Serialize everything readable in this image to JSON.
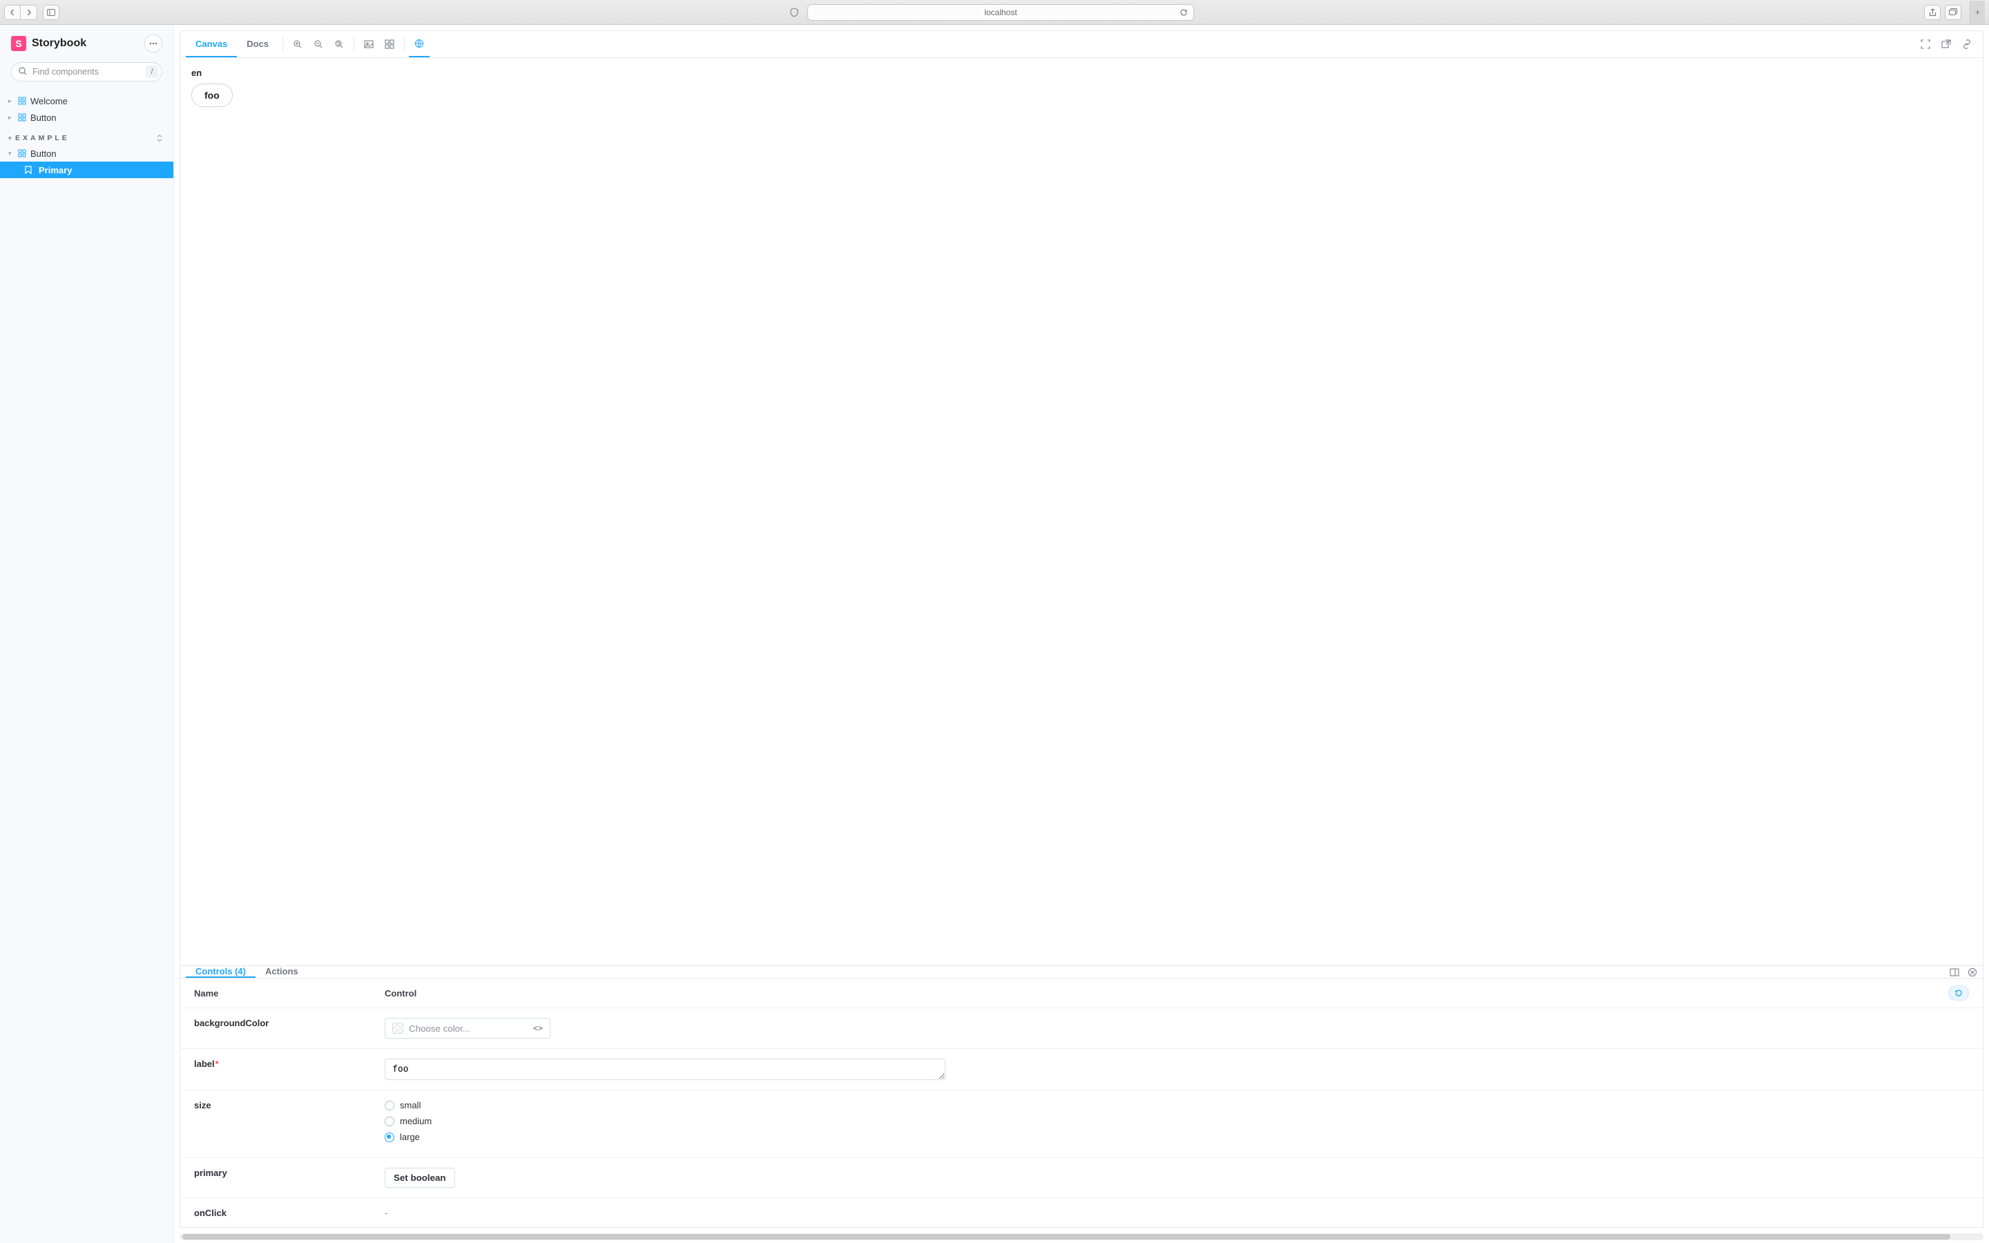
{
  "browser": {
    "url": "localhost"
  },
  "sidebar": {
    "brand": "Storybook",
    "search_placeholder": "Find components",
    "search_shortcut": "/",
    "root_items": [
      {
        "label": "Welcome"
      },
      {
        "label": "Button"
      }
    ],
    "sections": [
      {
        "title": "EXAMPLE",
        "components": [
          {
            "label": "Button",
            "expanded": true,
            "stories": [
              {
                "label": "Primary",
                "active": true
              }
            ]
          }
        ]
      }
    ]
  },
  "toolbar": {
    "tabs": [
      {
        "label": "Canvas",
        "active": true
      },
      {
        "label": "Docs",
        "active": false
      }
    ]
  },
  "canvas": {
    "locale": "en",
    "button_label": "foo"
  },
  "addons": {
    "tabs": [
      {
        "label": "Controls (4)",
        "active": true
      },
      {
        "label": "Actions",
        "active": false
      }
    ],
    "columns": {
      "name": "Name",
      "control": "Control"
    },
    "controls": {
      "backgroundColor": {
        "name": "backgroundColor",
        "placeholder": "Choose color..."
      },
      "label": {
        "name": "label",
        "required": true,
        "value": "foo"
      },
      "size": {
        "name": "size",
        "options": [
          "small",
          "medium",
          "large"
        ],
        "value": "large"
      },
      "primary": {
        "name": "primary",
        "button": "Set boolean"
      },
      "onClick": {
        "name": "onClick",
        "value": "-"
      }
    }
  }
}
